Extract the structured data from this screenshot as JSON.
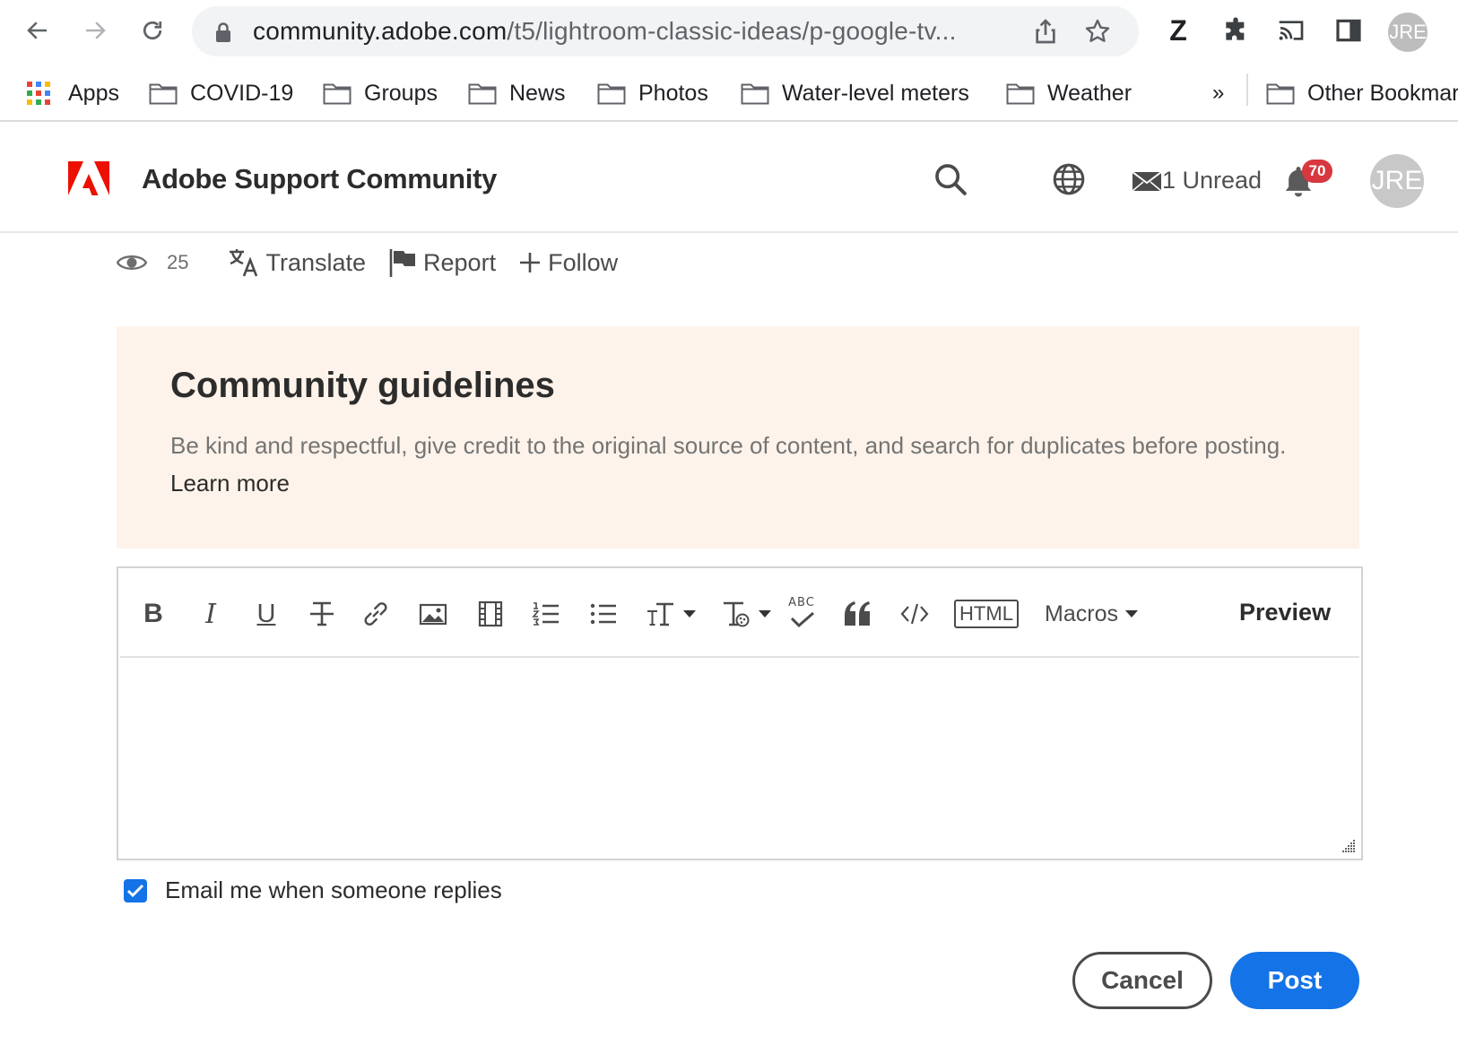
{
  "browser": {
    "url_host": "community.adobe.com",
    "url_path": "/t5/lightroom-classic-ideas/p-google-tv...",
    "extension_z": "Z",
    "profile_initials": "JRE"
  },
  "bookmarks": {
    "items": [
      {
        "label": "Apps",
        "icon": "apps-grid-icon"
      },
      {
        "label": "COVID-19",
        "icon": "folder-icon"
      },
      {
        "label": "Groups",
        "icon": "folder-icon"
      },
      {
        "label": "News",
        "icon": "folder-icon"
      },
      {
        "label": "Photos",
        "icon": "folder-icon"
      },
      {
        "label": "Water-level meters",
        "icon": "folder-icon"
      },
      {
        "label": "Weather",
        "icon": "folder-icon"
      }
    ],
    "overflow": "»",
    "other": "Other Bookmarks"
  },
  "site": {
    "title": "Adobe Support Community",
    "unread_label": "1 Unread",
    "notification_count": "70",
    "avatar_initials": "JRE",
    "brand_color": "#eb1000"
  },
  "actions": {
    "views": "25",
    "translate": "Translate",
    "report": "Report",
    "follow": "Follow"
  },
  "guidelines": {
    "title": "Community guidelines",
    "text": "Be kind and respectful, give credit to the original source of content, and search for duplicates before posting.",
    "link": "Learn more"
  },
  "editor": {
    "tools": [
      "bold-icon",
      "italic-icon",
      "underline-icon",
      "strikethrough-icon",
      "link-icon",
      "image-icon",
      "video-icon",
      "numbered-list-icon",
      "bullet-list-icon",
      "font-size-icon",
      "text-style-icon",
      "spellcheck-icon",
      "quote-icon",
      "code-icon",
      "html-icon"
    ],
    "bold": "B",
    "italic": "I",
    "underline": "U",
    "html_label": "HTML",
    "spell_label": "ABC",
    "macros_label": "Macros",
    "preview_label": "Preview",
    "body_value": ""
  },
  "form": {
    "email_label": "Email me when someone replies",
    "email_checked": true,
    "cancel_label": "Cancel",
    "post_label": "Post",
    "accent": "#1473e6"
  }
}
